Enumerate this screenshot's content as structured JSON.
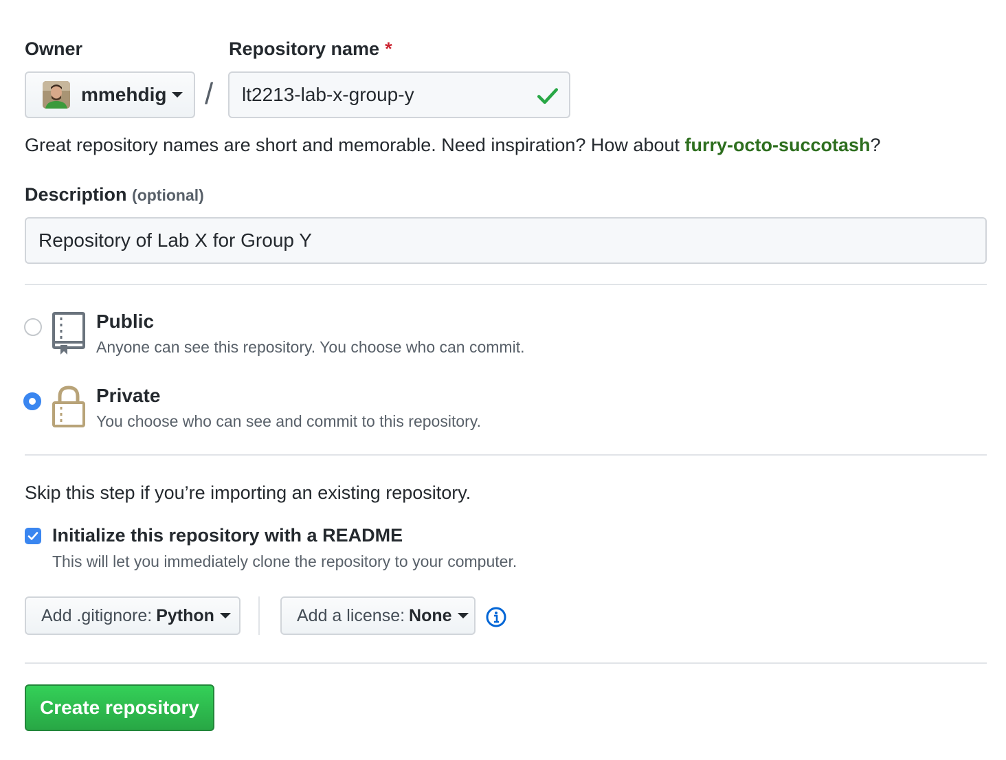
{
  "owner": {
    "label": "Owner",
    "username": "mmehdig"
  },
  "repo_name": {
    "label": "Repository name",
    "required_mark": "*",
    "value": "lt2213-lab-x-group-y",
    "valid": true
  },
  "slash": "/",
  "hint": {
    "prefix": "Great repository names are short and memorable. Need inspiration? How about ",
    "suggestion": "furry-octo-succotash",
    "suffix": "?"
  },
  "description": {
    "label": "Description",
    "optional": "(optional)",
    "value": "Repository of Lab X for Group Y"
  },
  "visibility": {
    "selected": "private",
    "public": {
      "title": "Public",
      "desc": "Anyone can see this repository. You choose who can commit."
    },
    "private": {
      "title": "Private",
      "desc": "You choose who can see and commit to this repository."
    }
  },
  "init": {
    "skip_text": "Skip this step if you’re importing an existing repository.",
    "readme_label": "Initialize this repository with a README",
    "readme_checked": true,
    "readme_desc": "This will let you immediately clone the repository to your computer."
  },
  "gitignore": {
    "prefix": "Add .gitignore:",
    "value": "Python"
  },
  "license": {
    "prefix": "Add a license:",
    "value": "None"
  },
  "create_button": "Create repository",
  "colors": {
    "accent_blue": "#3a86f0",
    "success_green": "#28a745",
    "suggestion_green": "#2d6e1e",
    "required_red": "#cb2431"
  }
}
